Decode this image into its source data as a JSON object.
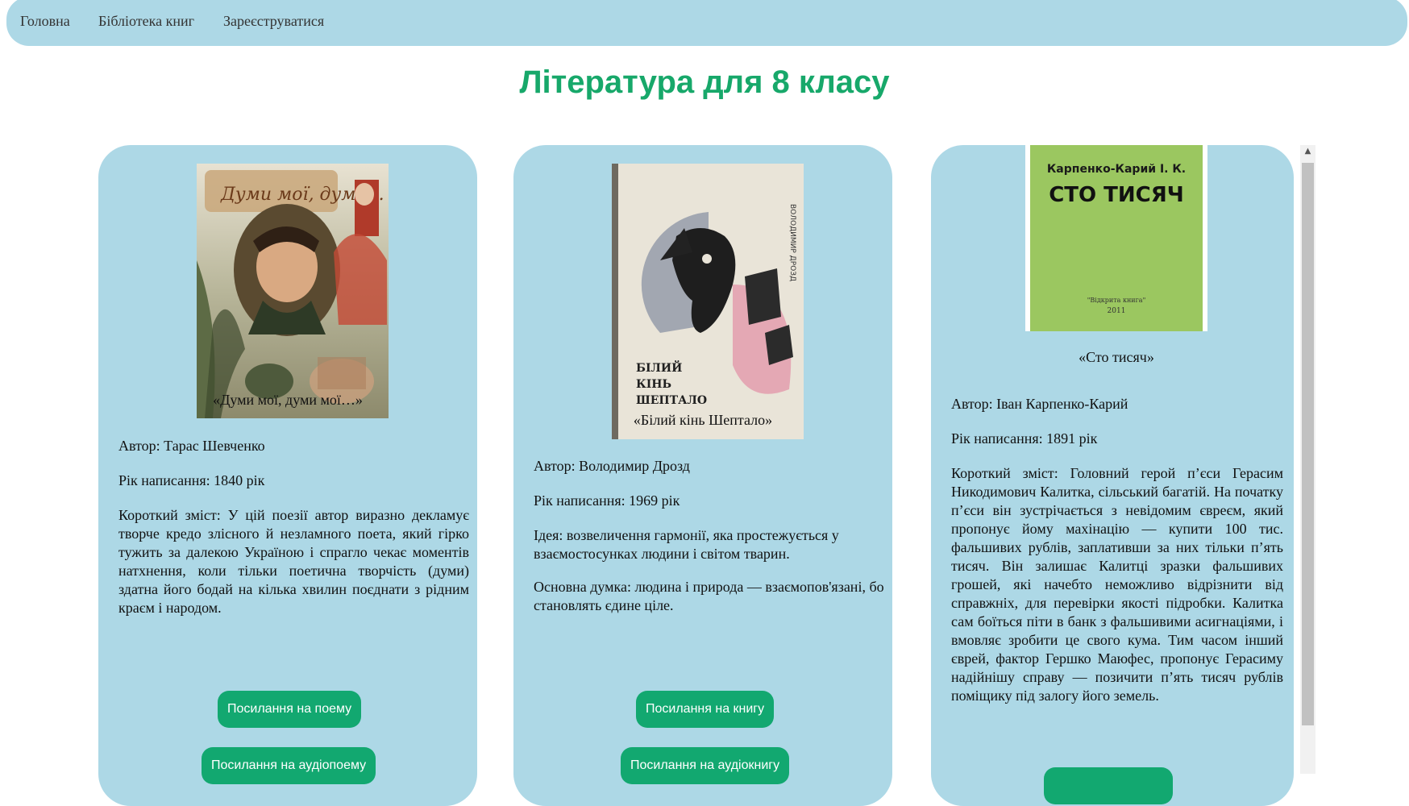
{
  "nav": {
    "home": "Головна",
    "library": "Бібліотека книг",
    "register": "Зареєструватися"
  },
  "page_title": "Література для 8 класу",
  "books": [
    {
      "cover_title": "Думи мої, думи...",
      "title": "«Думи мої, думи мої…»",
      "author": "Автор: Тарас Шевченко",
      "year": "Рік написання: 1840 рік",
      "summary": "Короткий зміст: У цій поезії автор виразно декламує творче кредо злісного й незламного поета, який гірко тужить за далекою Україною і спрагло чекає моментів натхнення, коли тільки поетична творчість (думи) здатна його бодай на кілька хвилин поєднати з рідним краєм і народом.",
      "link_label": "Посилання на поему",
      "audio_label": "Посилання на аудіопоему"
    },
    {
      "cover_title": "БІЛИЙ КІНЬ ШЕПТАЛО",
      "cover_author": "ВОЛОДИМИР ДРОЗД",
      "title": "«Білий кінь Шептало»",
      "author": "Автор: Володимир Дрозд",
      "year": "Рік написання: 1969 рік",
      "idea": "Ідея: возвеличення гармонії, яка простежується у взаємостосунках людини і світом тварин.",
      "main_thought": "Основна думка: людина і природа — взаємопов'язані, бо становлять єдине ціле.",
      "link_label": "Посилання на книгу",
      "audio_label": "Посилання на аудіокнигу"
    },
    {
      "cover_author": "Карпенко-Карий І. К.",
      "cover_title": "СТО ТИСЯЧ",
      "cover_publisher": "\"Відкрита книга\"",
      "cover_year": "2011",
      "title": "«Сто тисяч»",
      "author": "Автор: Іван Карпенко-Карий",
      "year": "Рік написання: 1891 рік",
      "summary": "Короткий зміст: Головний герой п’єси Герасим Никодимович Калитка, сільський багатій. На початку п’єси він зустрічається з невідомим євреєм, який пропонує йому махінацію — купити 100 тис. фальшивих рублів, заплативши за них тільки п’ять тисяч. Він залишає Калитці зразки фальшивих грошей, які начебто неможливо відрізнити від справжніх, для перевірки якості підробки. Калитка сам боїться піти в банк з фальшивими асигнаціями, і вмовляє зробити це свого кума. Тим часом інший єврей, фактор Гершко Маюфес, пропонує Герасиму надійнішу справу — позичити п’ять тисяч рублів поміщику під залогу його земель."
    }
  ],
  "colors": {
    "nav_bg": "#add8e6",
    "card_bg": "#add8e6",
    "title_green": "#17a86a",
    "button_green": "#12a870"
  }
}
